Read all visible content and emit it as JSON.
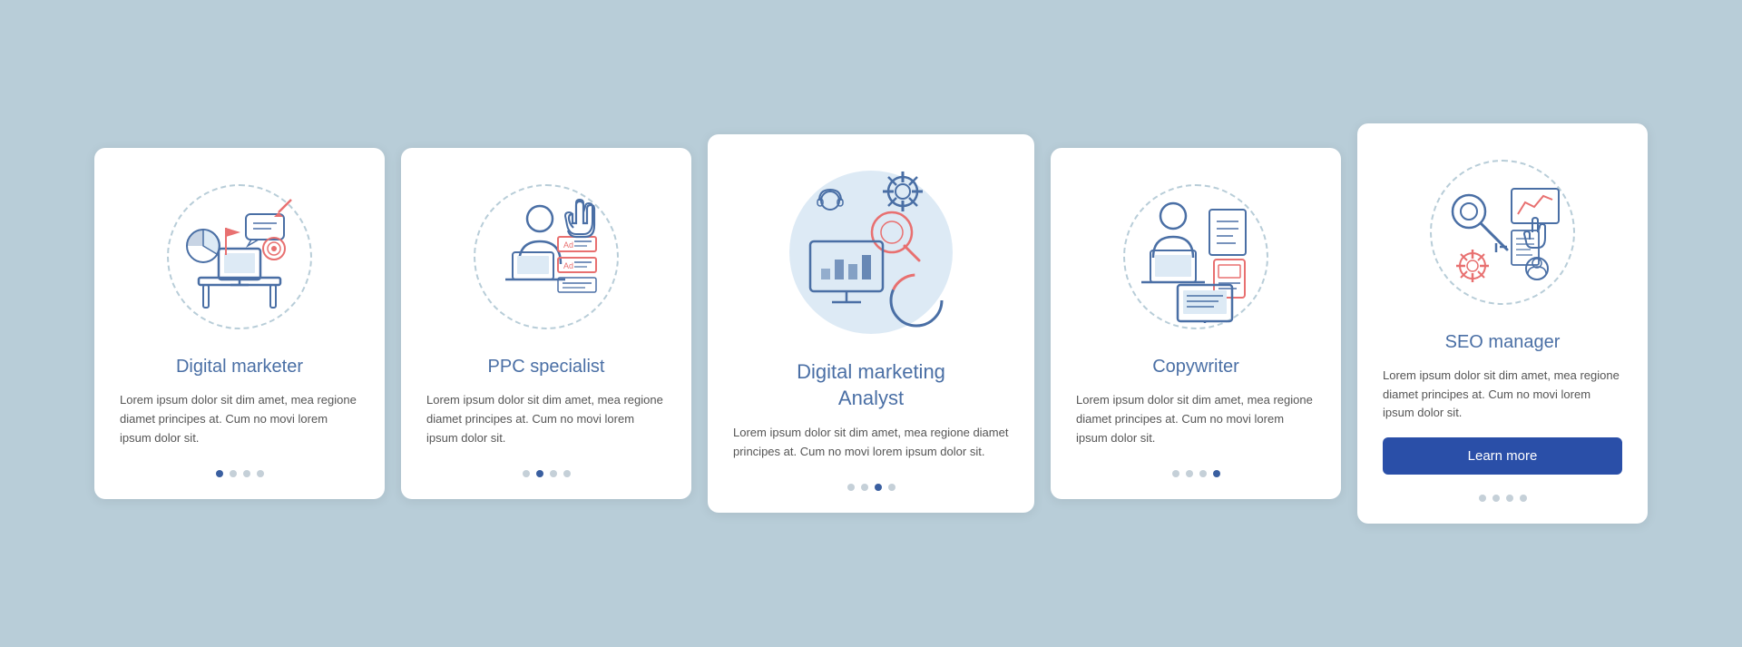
{
  "cards": [
    {
      "id": "digital-marketer",
      "title": "Digital marketer",
      "description": "Lorem ipsum dolor sit dim amet, mea regione diamet principes at. Cum no movi lorem ipsum dolor sit.",
      "dots": [
        true,
        false,
        false,
        false
      ],
      "active_dot": 0,
      "has_button": false,
      "button_label": ""
    },
    {
      "id": "ppc-specialist",
      "title": "PPC specialist",
      "description": "Lorem ipsum dolor sit dim amet, mea regione diamet principes at. Cum no movi lorem ipsum dolor sit.",
      "dots": [
        false,
        true,
        false,
        false
      ],
      "active_dot": 1,
      "has_button": false,
      "button_label": ""
    },
    {
      "id": "digital-marketing-analyst",
      "title": "Digital marketing\nAnalyst",
      "description": "Lorem ipsum dolor sit dim amet, mea regione diamet principes at. Cum no movi lorem ipsum dolor sit.",
      "dots": [
        false,
        false,
        true,
        false
      ],
      "active_dot": 2,
      "has_button": false,
      "button_label": "",
      "is_center": true
    },
    {
      "id": "copywriter",
      "title": "Copywriter",
      "description": "Lorem ipsum dolor sit dim amet, mea regione diamet principes at. Cum no movi lorem ipsum dolor sit.",
      "dots": [
        false,
        false,
        false,
        true
      ],
      "active_dot": 3,
      "has_button": false,
      "button_label": ""
    },
    {
      "id": "seo-manager",
      "title": "SEO manager",
      "description": "Lorem ipsum dolor sit dim amet, mea regione diamet principes at. Cum no movi lorem ipsum dolor sit.",
      "dots": [
        false,
        false,
        false,
        false
      ],
      "active_dot": -1,
      "has_button": true,
      "button_label": "Learn more"
    }
  ],
  "dot_count": 4,
  "accent_color": "#2a4fa8",
  "icon_color": "#4a6fa5",
  "icon_red": "#e87070"
}
